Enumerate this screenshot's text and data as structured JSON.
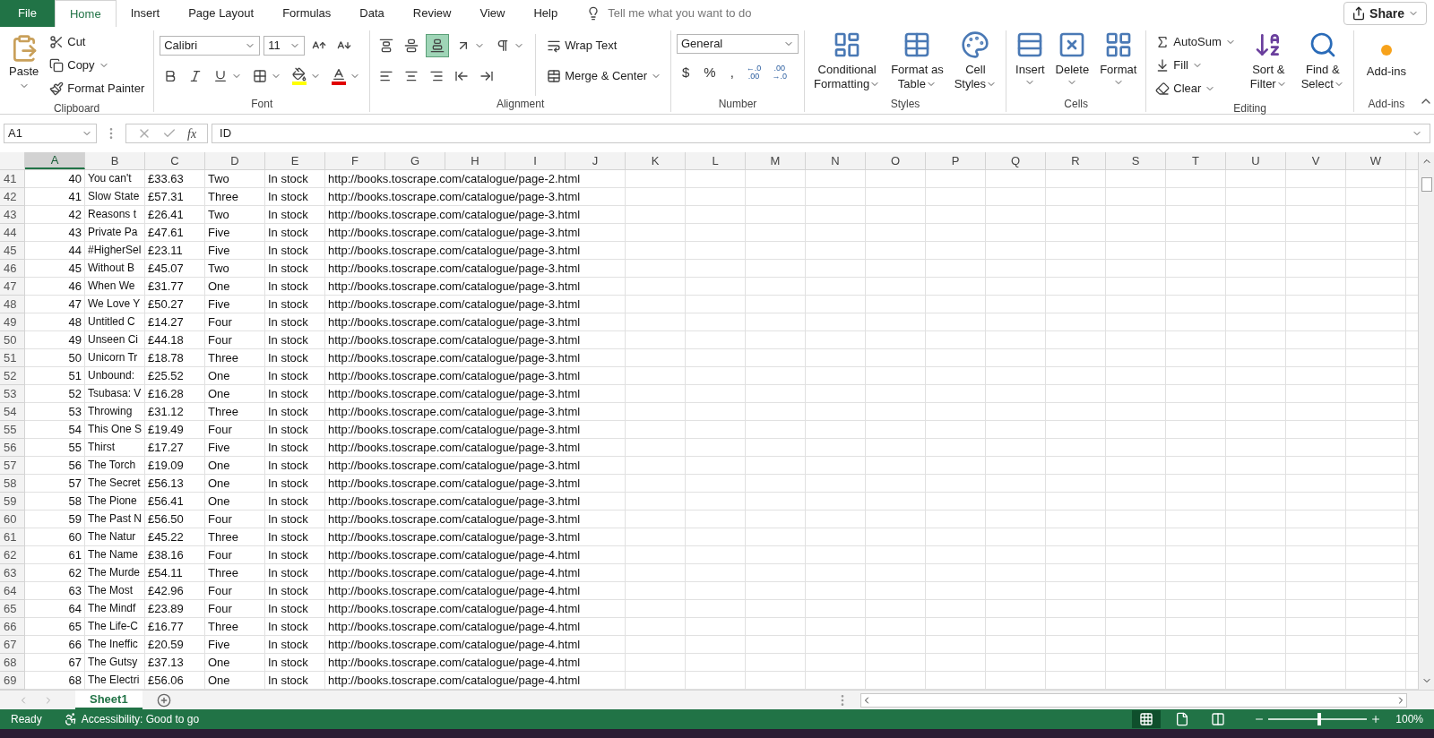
{
  "tabs": [
    {
      "label": "File",
      "kind": "file",
      "selected": false
    },
    {
      "label": "Home",
      "kind": "tab",
      "selected": true
    },
    {
      "label": "Insert",
      "kind": "tab",
      "selected": false
    },
    {
      "label": "Page Layout",
      "kind": "tab",
      "selected": false
    },
    {
      "label": "Formulas",
      "kind": "tab",
      "selected": false
    },
    {
      "label": "Data",
      "kind": "tab",
      "selected": false
    },
    {
      "label": "Review",
      "kind": "tab",
      "selected": false
    },
    {
      "label": "View",
      "kind": "tab",
      "selected": false
    },
    {
      "label": "Help",
      "kind": "tab",
      "selected": false
    }
  ],
  "tell_me": {
    "placeholder": "Tell me what you want to do"
  },
  "share": "Share",
  "ribbon": {
    "clipboard": {
      "label": "Clipboard",
      "paste": "Paste",
      "cut": "Cut",
      "copy": "Copy",
      "format_painter": "Format Painter"
    },
    "font": {
      "label": "Font",
      "name": "Calibri",
      "size": "11"
    },
    "alignment": {
      "label": "Alignment",
      "vertical": [
        {
          "kind": "top",
          "selected": false
        },
        {
          "kind": "middle",
          "selected": false
        },
        {
          "kind": "bottom",
          "selected": true
        }
      ],
      "wrap_text": "Wrap Text",
      "merge": "Merge & Center"
    },
    "number": {
      "label": "Number",
      "format": "General",
      "symbols": [
        "$",
        "%",
        ","
      ],
      "decimals": [
        [
          "←.0",
          ".00"
        ],
        [
          ".00",
          "→.0"
        ]
      ]
    },
    "styles": {
      "label": "Styles",
      "buttons": [
        {
          "kind": "conditional",
          "lines": [
            "Conditional",
            "Formatting"
          ]
        },
        {
          "kind": "table",
          "lines": [
            "Format as",
            "Table"
          ]
        },
        {
          "kind": "cell_styles",
          "lines": [
            "Cell",
            "Styles"
          ]
        }
      ]
    },
    "cells": {
      "label": "Cells",
      "buttons": [
        {
          "kind": "insert",
          "label": "Insert"
        },
        {
          "kind": "delete",
          "label": "Delete"
        },
        {
          "kind": "format",
          "label": "Format"
        }
      ]
    },
    "editing": {
      "label": "Editing",
      "autosum": "AutoSum",
      "fill": "Fill",
      "clear": "Clear",
      "sort": [
        "Sort &",
        "Filter"
      ],
      "find": [
        "Find &",
        "Select"
      ]
    },
    "addins": {
      "label": "Add-ins",
      "button": "Add-ins"
    }
  },
  "formula_bar": {
    "name_box": "A1",
    "fx": "fx",
    "value": "ID"
  },
  "sheet": {
    "columns": [
      {
        "label": "A",
        "selected": true
      },
      {
        "label": "B",
        "selected": false
      },
      {
        "label": "C",
        "selected": false
      },
      {
        "label": "D",
        "selected": false
      },
      {
        "label": "E",
        "selected": false
      },
      {
        "label": "F",
        "selected": false
      },
      {
        "label": "G",
        "selected": false
      },
      {
        "label": "H",
        "selected": false
      },
      {
        "label": "I",
        "selected": false
      },
      {
        "label": "J",
        "selected": false
      },
      {
        "label": "K",
        "selected": false
      },
      {
        "label": "L",
        "selected": false
      },
      {
        "label": "M",
        "selected": false
      },
      {
        "label": "N",
        "selected": false
      },
      {
        "label": "O",
        "selected": false
      },
      {
        "label": "P",
        "selected": false
      },
      {
        "label": "Q",
        "selected": false
      },
      {
        "label": "R",
        "selected": false
      },
      {
        "label": "S",
        "selected": false
      },
      {
        "label": "T",
        "selected": false
      },
      {
        "label": "U",
        "selected": false
      },
      {
        "label": "V",
        "selected": false
      },
      {
        "label": "W",
        "selected": false
      }
    ],
    "rows": [
      {
        "row": "41",
        "cells": [
          "40",
          "You can't",
          "£33.63",
          "Two",
          "In stock",
          "http://books.toscrape.com/catalogue/page-2.html"
        ]
      },
      {
        "row": "42",
        "cells": [
          "41",
          "Slow State",
          "£57.31",
          "Three",
          "In stock",
          "http://books.toscrape.com/catalogue/page-3.html"
        ]
      },
      {
        "row": "43",
        "cells": [
          "42",
          "Reasons t",
          "£26.41",
          "Two",
          "In stock",
          "http://books.toscrape.com/catalogue/page-3.html"
        ]
      },
      {
        "row": "44",
        "cells": [
          "43",
          "Private Pa",
          "£47.61",
          "Five",
          "In stock",
          "http://books.toscrape.com/catalogue/page-3.html"
        ]
      },
      {
        "row": "45",
        "cells": [
          "44",
          "#HigherSel",
          "£23.11",
          "Five",
          "In stock",
          "http://books.toscrape.com/catalogue/page-3.html"
        ]
      },
      {
        "row": "46",
        "cells": [
          "45",
          "Without B",
          "£45.07",
          "Two",
          "In stock",
          "http://books.toscrape.com/catalogue/page-3.html"
        ]
      },
      {
        "row": "47",
        "cells": [
          "46",
          "When We",
          "£31.77",
          "One",
          "In stock",
          "http://books.toscrape.com/catalogue/page-3.html"
        ]
      },
      {
        "row": "48",
        "cells": [
          "47",
          "We Love Y",
          "£50.27",
          "Five",
          "In stock",
          "http://books.toscrape.com/catalogue/page-3.html"
        ]
      },
      {
        "row": "49",
        "cells": [
          "48",
          "Untitled C",
          "£14.27",
          "Four",
          "In stock",
          "http://books.toscrape.com/catalogue/page-3.html"
        ]
      },
      {
        "row": "50",
        "cells": [
          "49",
          "Unseen Ci",
          "£44.18",
          "Four",
          "In stock",
          "http://books.toscrape.com/catalogue/page-3.html"
        ]
      },
      {
        "row": "51",
        "cells": [
          "50",
          "Unicorn Tr",
          "£18.78",
          "Three",
          "In stock",
          "http://books.toscrape.com/catalogue/page-3.html"
        ]
      },
      {
        "row": "52",
        "cells": [
          "51",
          "Unbound:",
          "£25.52",
          "One",
          "In stock",
          "http://books.toscrape.com/catalogue/page-3.html"
        ]
      },
      {
        "row": "53",
        "cells": [
          "52",
          "Tsubasa: V",
          "£16.28",
          "One",
          "In stock",
          "http://books.toscrape.com/catalogue/page-3.html"
        ]
      },
      {
        "row": "54",
        "cells": [
          "53",
          "Throwing",
          "£31.12",
          "Three",
          "In stock",
          "http://books.toscrape.com/catalogue/page-3.html"
        ]
      },
      {
        "row": "55",
        "cells": [
          "54",
          "This One S",
          "£19.49",
          "Four",
          "In stock",
          "http://books.toscrape.com/catalogue/page-3.html"
        ]
      },
      {
        "row": "56",
        "cells": [
          "55",
          "Thirst",
          "£17.27",
          "Five",
          "In stock",
          "http://books.toscrape.com/catalogue/page-3.html"
        ]
      },
      {
        "row": "57",
        "cells": [
          "56",
          "The Torch",
          "£19.09",
          "One",
          "In stock",
          "http://books.toscrape.com/catalogue/page-3.html"
        ]
      },
      {
        "row": "58",
        "cells": [
          "57",
          "The Secret",
          "£56.13",
          "One",
          "In stock",
          "http://books.toscrape.com/catalogue/page-3.html"
        ]
      },
      {
        "row": "59",
        "cells": [
          "58",
          "The Pione",
          "£56.41",
          "One",
          "In stock",
          "http://books.toscrape.com/catalogue/page-3.html"
        ]
      },
      {
        "row": "60",
        "cells": [
          "59",
          "The Past N",
          "£56.50",
          "Four",
          "In stock",
          "http://books.toscrape.com/catalogue/page-3.html"
        ]
      },
      {
        "row": "61",
        "cells": [
          "60",
          "The Natur",
          "£45.22",
          "Three",
          "In stock",
          "http://books.toscrape.com/catalogue/page-3.html"
        ]
      },
      {
        "row": "62",
        "cells": [
          "61",
          "The Name",
          "£38.16",
          "Four",
          "In stock",
          "http://books.toscrape.com/catalogue/page-4.html"
        ]
      },
      {
        "row": "63",
        "cells": [
          "62",
          "The Murde",
          "£54.11",
          "Three",
          "In stock",
          "http://books.toscrape.com/catalogue/page-4.html"
        ]
      },
      {
        "row": "64",
        "cells": [
          "63",
          "The Most",
          "£42.96",
          "Four",
          "In stock",
          "http://books.toscrape.com/catalogue/page-4.html"
        ]
      },
      {
        "row": "65",
        "cells": [
          "64",
          "The Mindf",
          "£23.89",
          "Four",
          "In stock",
          "http://books.toscrape.com/catalogue/page-4.html"
        ]
      },
      {
        "row": "66",
        "cells": [
          "65",
          "The Life-C",
          "£16.77",
          "Three",
          "In stock",
          "http://books.toscrape.com/catalogue/page-4.html"
        ]
      },
      {
        "row": "67",
        "cells": [
          "66",
          "The Ineffic",
          "£20.59",
          "Five",
          "In stock",
          "http://books.toscrape.com/catalogue/page-4.html"
        ]
      },
      {
        "row": "68",
        "cells": [
          "67",
          "The Gutsy",
          "£37.13",
          "One",
          "In stock",
          "http://books.toscrape.com/catalogue/page-4.html"
        ]
      },
      {
        "row": "69",
        "cells": [
          "68",
          "The Electri",
          "£56.06",
          "One",
          "In stock",
          "http://books.toscrape.com/catalogue/page-4.html"
        ]
      }
    ]
  },
  "sheet_tabs": [
    {
      "label": "Sheet1",
      "selected": true
    }
  ],
  "status_bar": {
    "ready": "Ready",
    "accessibility": "Accessibility: Good to go",
    "views": [
      {
        "kind": "normal",
        "selected": true
      },
      {
        "kind": "page_layout",
        "selected": false
      },
      {
        "kind": "page_break",
        "selected": false
      }
    ],
    "zoom": {
      "level": 0.52,
      "reading": "100%"
    }
  }
}
